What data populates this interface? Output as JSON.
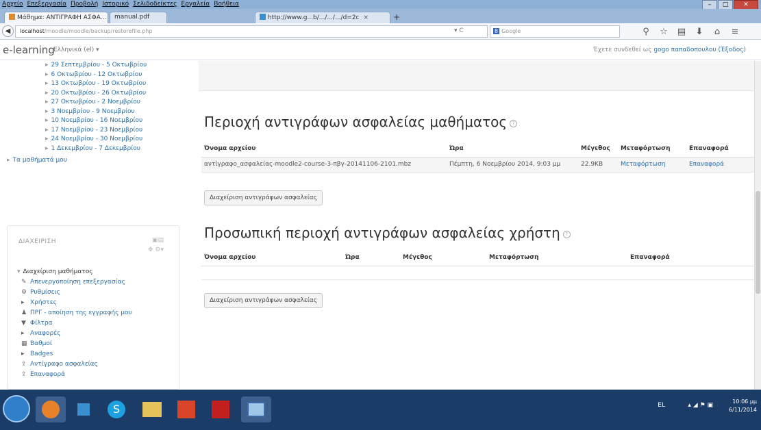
{
  "browser": {
    "menu": [
      "Αρχείο",
      "Επεξεργασία",
      "Προβολή",
      "Ιστορικό",
      "Σελιδοδείκτες",
      "Εργαλεία",
      "Βοήθεια"
    ],
    "tabs": [
      {
        "label": "Μάθημα: ΑΝΤΙΓΡΑΦΗ ΑΣΦΑ..."
      },
      {
        "label": "manual.pdf"
      },
      {
        "label": "http://www.g...b/.../.../.../d=2c"
      }
    ],
    "url": {
      "host": "localhost",
      "path": "/moodle/moodle/backup/restorefile.php"
    },
    "search_placeholder": "Google"
  },
  "moodle": {
    "brand": "e-learning",
    "language": "Ελληνικά (el) ▾",
    "login_prefix": "Έχετε συνδεθεί ως",
    "login_user": "gogo παπαδοπουλου",
    "login_suffix": "(Έξοδος)"
  },
  "nav": {
    "items": [
      "29 Σεπτεμβρίου - 5 Οκτωβρίου",
      "6 Οκτωβρίου - 12 Οκτωβρίου",
      "13 Οκτωβρίου - 19 Οκτωβρίου",
      "20 Οκτωβρίου - 26 Οκτωβρίου",
      "27 Οκτωβρίου - 2 Νοεμβρίου",
      "3 Νοεμβρίου - 9 Νοεμβρίου",
      "10 Νοεμβρίου - 16 Νοεμβρίου",
      "17 Νοεμβρίου - 23 Νοεμβρίου",
      "24 Νοεμβρίου - 30 Νοεμβρίου",
      "1 Δεκεμβρίου - 7 Δεκεμβρίου"
    ],
    "my_courses": "Τα μαθήματά μου"
  },
  "admin": {
    "title": "ΔΙΑΧΕΙΡΙΣΗ",
    "section": "Διαχείριση μαθήματος",
    "items": [
      {
        "icon": "pencil-icon",
        "label": "Απενεργοποίηση επεξεργασίας"
      },
      {
        "icon": "gear-icon",
        "label": "Ρυθμίσεις"
      },
      {
        "icon": "arrow-icon",
        "label": "Χρήστες"
      },
      {
        "icon": "user-icon",
        "label": "ΠΡΓ - αποίηση της εγγραφής μου"
      },
      {
        "icon": "filter-icon",
        "label": "Φίλτρα"
      },
      {
        "icon": "arrow-icon",
        "label": "Αναφορές"
      },
      {
        "icon": "grades-icon",
        "label": "Βαθμοί"
      },
      {
        "icon": "arrow-icon",
        "label": "Badges"
      },
      {
        "icon": "backup-icon",
        "label": "Αντίγραφο ασφαλείας"
      },
      {
        "icon": "restore-icon",
        "label": "Επαναφορά"
      }
    ]
  },
  "course_backup": {
    "title": "Περιοχή αντιγράφων ασφαλείας μαθήματος",
    "headers": [
      "Όνομα αρχείου",
      "Ώρα",
      "Μέγεθος",
      "Μεταφόρτωση",
      "Επαναφορά"
    ],
    "rows": [
      {
        "filename": "αντίγραφο_ασφαλείας-moodle2-course-3-πβγ-20141106-2101.mbz",
        "time": "Πέμπτη, 6 Νοεμβρίου 2014, 9:03 μμ",
        "size": "22.9KB",
        "download": "Μεταφόρτωση",
        "restore": "Επαναφορά"
      }
    ],
    "manage_button": "Διαχείριση αντιγράφων ασφαλείας"
  },
  "user_backup": {
    "title": "Προσωπική περιοχή αντιγράφων ασφαλείας χρήστη",
    "headers": [
      "Όνομα αρχείου",
      "Ώρα",
      "Μέγεθος",
      "Μεταφόρτωση",
      "Επαναφορά"
    ],
    "manage_button": "Διαχείριση αντιγράφων ασφαλείας"
  },
  "taskbar": {
    "tray_lang": "EL",
    "time": "10:06 μμ",
    "date": "6/11/2014"
  }
}
